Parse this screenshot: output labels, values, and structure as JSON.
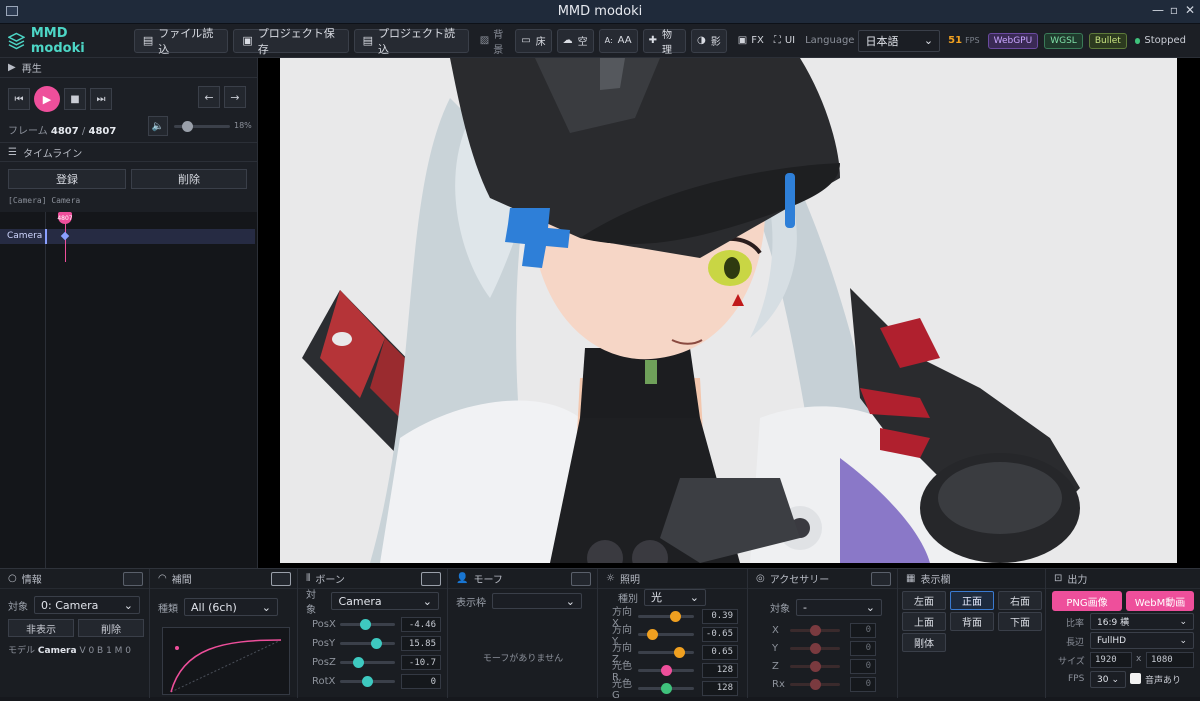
{
  "window": {
    "title": "MMD modoki"
  },
  "toolbar": {
    "app_name": "MMD modoki",
    "buttons": [
      {
        "label": "ファイル読込",
        "icon": "file-icon"
      },
      {
        "label": "プロジェクト保存",
        "icon": "save-icon"
      },
      {
        "label": "プロジェクト読込",
        "icon": "folder-icon"
      }
    ],
    "bg_label": "背景",
    "toggles": [
      {
        "label": "床",
        "icon": "floor-icon"
      },
      {
        "label": "空",
        "icon": "sky-icon"
      },
      {
        "label": "AA",
        "icon": "aa-icon"
      },
      {
        "label": "物理",
        "icon": "physics-icon"
      },
      {
        "label": "影",
        "icon": "shadow-icon"
      }
    ],
    "fx_label": "FX",
    "ui_label": "UI",
    "language_label": "Language",
    "language_value": "日本語",
    "fps_value": "51",
    "fps_label": "FPS",
    "badges": [
      "WebGPU",
      "WGSL",
      "Bullet"
    ],
    "status": "Stopped"
  },
  "playback": {
    "section_label": "再生",
    "frame_label": "フレーム",
    "frame_current": "4807",
    "frame_sep": "/",
    "frame_total": "4807",
    "volume_percent": "18%",
    "volume_level": 0.18,
    "prev_arrow": "←",
    "next_arrow": "→"
  },
  "timeline": {
    "section_label": "タイムライン",
    "register_label": "登録",
    "delete_label": "削除",
    "track_caption": "[Camera] Camera",
    "playhead_frame": "4807",
    "tracks": [
      "Camera"
    ]
  },
  "info_panel": {
    "title": "情報",
    "target_label": "対象",
    "target_value": "0: Camera",
    "hide_label": "非表示",
    "delete_label": "削除",
    "model_label": "モデル",
    "model_value": "Camera",
    "counts": "V 0   B 1   M 0"
  },
  "interp_panel": {
    "title": "補間",
    "type_label": "種類",
    "type_value": "All (6ch)"
  },
  "bone_panel": {
    "title": "ボーン",
    "target_label": "対象",
    "target_value": "Camera",
    "sliders": [
      {
        "label": "PosX",
        "value": "-4.46",
        "level": 0.45
      },
      {
        "label": "PosY",
        "value": "15.85",
        "level": 0.7
      },
      {
        "label": "PosZ",
        "value": "-10.7",
        "level": 0.3
      },
      {
        "label": "RotX",
        "value": "0",
        "level": 0.5
      }
    ]
  },
  "morph_panel": {
    "title": "モーフ",
    "frame_label": "表示枠",
    "empty": "モーフがありません"
  },
  "light_panel": {
    "title": "照明",
    "kind_label": "種別",
    "kind_value": "光",
    "sliders": [
      {
        "label": "方向X",
        "value": "0.39",
        "level": 0.7
      },
      {
        "label": "方向Y",
        "value": "-0.65",
        "level": 0.2
      },
      {
        "label": "方向Z",
        "value": "0.65",
        "level": 0.8
      },
      {
        "label": "光色R",
        "value": "128",
        "level": 0.5
      },
      {
        "label": "光色G",
        "value": "128",
        "level": 0.5
      }
    ]
  },
  "accessory_panel": {
    "title": "アクセサリー",
    "target_label": "対象",
    "target_value": "-",
    "sliders": [
      {
        "label": "X",
        "value": "0"
      },
      {
        "label": "Y",
        "value": "0"
      },
      {
        "label": "Z",
        "value": "0"
      },
      {
        "label": "Rx",
        "value": "0"
      }
    ]
  },
  "view_panel": {
    "title": "表示欄",
    "buttons": [
      "左面",
      "正面",
      "右面",
      "上面",
      "背面",
      "下面",
      "剛体"
    ],
    "active": "正面"
  },
  "output_panel": {
    "title": "出力",
    "png_label": "PNG画像",
    "webm_label": "WebM動画",
    "ratio_label": "比率",
    "ratio_value": "16:9 横",
    "long_label": "長辺",
    "long_value": "FullHD",
    "size_label": "サイズ",
    "width": "1920",
    "x": "x",
    "height": "1080",
    "fps_label": "FPS",
    "fps_value": "30",
    "audio_label": "音声あり"
  },
  "colors": {
    "accent": "#4dd6c6",
    "pink": "#ee4f9b",
    "slider_knob": "#3ec9c0",
    "light_knob": "#f0a020"
  }
}
